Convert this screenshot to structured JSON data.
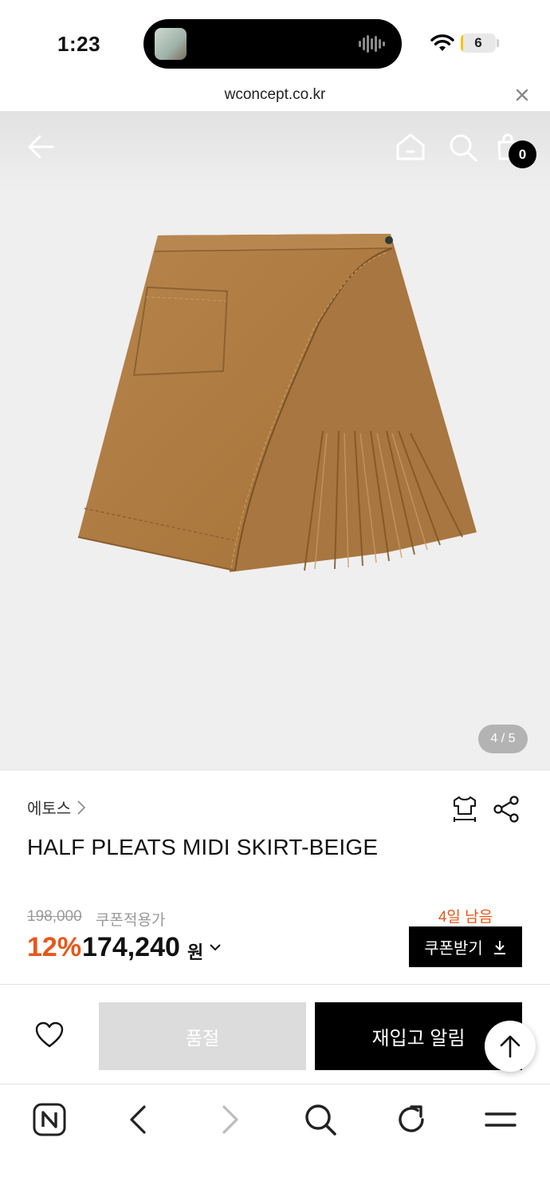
{
  "status_bar": {
    "time": "1:23",
    "battery_level": "6",
    "battery_fraction": 0.06,
    "wifi_icon": "wifi-icon"
  },
  "browser": {
    "url": "wconcept.co.kr",
    "close_icon": "close-icon"
  },
  "header": {
    "back_icon": "arrow-left-icon",
    "home_icon": "home-icon",
    "search_icon": "search-icon",
    "cart_icon": "shopping-bag-icon",
    "cart_count": "0"
  },
  "gallery": {
    "counter": "4 / 5"
  },
  "product": {
    "brand": "에토스",
    "title": "HALF PLEATS MIDI SKIRT-BEIGE",
    "original_price": "198,000",
    "coupon_label": "쿠폰적용가",
    "discount": "12%",
    "sale_price": "174,240",
    "currency": "원",
    "coupon_days_left": "4일 남음",
    "coupon_button": "쿠폰받기"
  },
  "actions": {
    "sold_out": "품절",
    "restock_alert": "재입고 알림"
  },
  "toolbar": {
    "items": [
      "naver-icon",
      "back-icon",
      "forward-icon",
      "search-icon",
      "reload-icon",
      "menu-icon"
    ]
  },
  "colors": {
    "accent": "#e8571a",
    "skirt": "#b07d45",
    "hero_bg": "#efefef"
  }
}
